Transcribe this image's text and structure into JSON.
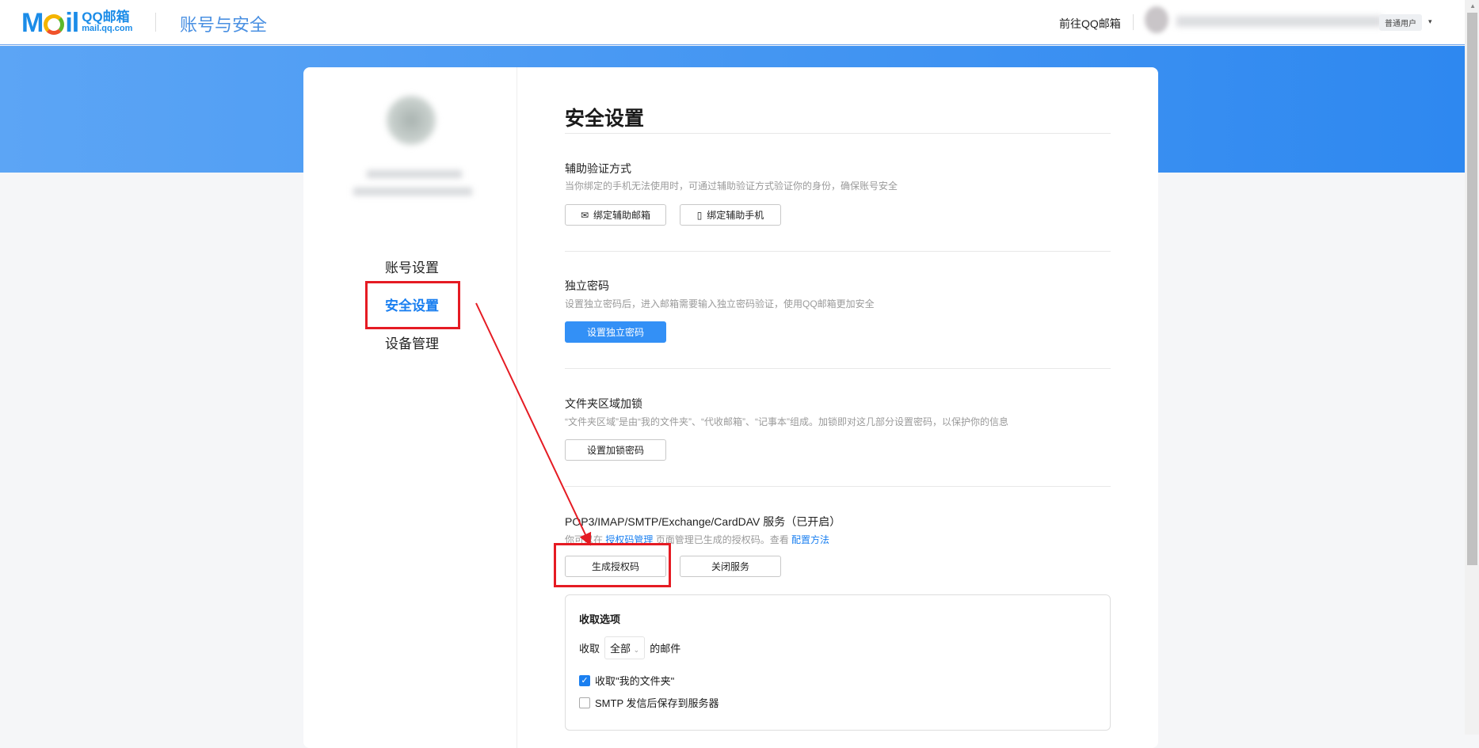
{
  "header": {
    "logo_brand": "QQ邮箱",
    "logo_domain": "mail.qq.com",
    "title": "账号与安全",
    "goto_mail": "前往QQ邮箱",
    "user_type": "普通用户",
    "caret": "▾"
  },
  "sidebar": {
    "items": [
      {
        "label": "账号设置"
      },
      {
        "label": "安全设置"
      },
      {
        "label": "设备管理"
      }
    ]
  },
  "main": {
    "title": "安全设置",
    "aux": {
      "title": "辅助验证方式",
      "desc": "当你绑定的手机无法使用时，可通过辅助验证方式验证你的身份，确保账号安全",
      "btn_email": "绑定辅助邮箱",
      "btn_phone": "绑定辅助手机"
    },
    "pwd": {
      "title": "独立密码",
      "desc": "设置独立密码后，进入邮箱需要输入独立密码验证，使用QQ邮箱更加安全",
      "btn": "设置独立密码"
    },
    "lock": {
      "title": "文件夹区域加锁",
      "desc": "“文件夹区域”是由“我的文件夹”、“代收邮箱”、“记事本”组成。加锁即对这几部分设置密码，以保护你的信息",
      "btn": "设置加锁密码"
    },
    "pop": {
      "title": "POP3/IMAP/SMTP/Exchange/CardDAV 服务（已开启）",
      "desc_pre": "你可以在 ",
      "link1": "授权码管理",
      "desc_mid": " 页面管理已生成的授权码。查看 ",
      "link2": "配置方法",
      "btn_gen": "生成授权码",
      "btn_close": "关闭服务"
    },
    "recv": {
      "title": "收取选项",
      "prefix": "收取",
      "select": "全部",
      "suffix": "的邮件",
      "opt1": "收取\"我的文件夹\"",
      "opt1_checked": true,
      "opt2": "SMTP 发信后保存到服务器",
      "opt2_checked": false
    }
  },
  "colors": {
    "accent": "#3390f6",
    "annotation": "#e51b23"
  }
}
